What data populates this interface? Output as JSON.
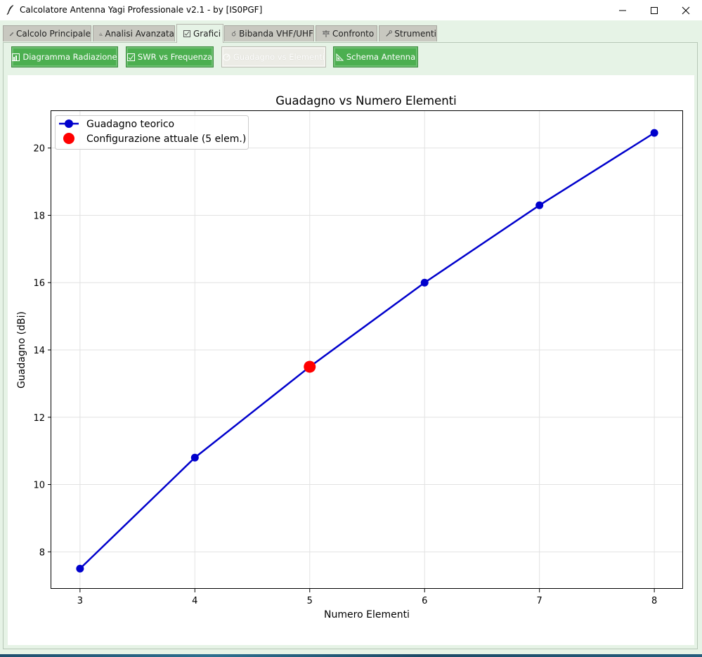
{
  "window": {
    "title": "Calcolatore Antenna Yagi Professionale v2.1 - by [IS0PGF]",
    "icon": "feather-icon",
    "controls": [
      "minimize-icon",
      "maximize-icon",
      "close-icon"
    ]
  },
  "tabs": [
    {
      "label": "Calcolo Principale",
      "icon": "pencil-icon",
      "active": false
    },
    {
      "label": "Analisi Avanzata",
      "icon": "chart-icon",
      "active": false
    },
    {
      "label": "Grafici",
      "icon": "checkbox-icon",
      "active": true
    },
    {
      "label": "Bibanda VHF/UHF",
      "icon": "satellite-icon",
      "active": false
    },
    {
      "label": "Confronto",
      "icon": "scales-icon",
      "active": false
    },
    {
      "label": "Strumenti",
      "icon": "tool-icon",
      "active": false
    }
  ],
  "chart_buttons": [
    {
      "label": "Diagramma Radiazione",
      "icon": "bar-chart-icon",
      "enabled": true
    },
    {
      "label": "SWR vs Frequenza",
      "icon": "checkbox-icon",
      "enabled": true
    },
    {
      "label": "Guadagno vs Elementi",
      "icon": "gauge-icon",
      "enabled": false
    },
    {
      "label": "Schema Antenna",
      "icon": "ruler-triangle-icon",
      "enabled": true
    }
  ],
  "chart_data": {
    "type": "line",
    "title": "Guadagno vs Numero Elementi",
    "xlabel": "Numero Elementi",
    "ylabel": "Guadagno (dBi)",
    "x": [
      3,
      4,
      5,
      6,
      7,
      8
    ],
    "series": [
      {
        "name": "Guadagno teorico",
        "values": [
          7.5,
          10.8,
          13.5,
          16.0,
          18.3,
          20.45
        ],
        "color": "#0000cc"
      }
    ],
    "highlight": {
      "name": "Configurazione attuale (5 elem.)",
      "x": 5,
      "y": 13.5,
      "color": "#ff0000"
    },
    "xlim": [
      2.75,
      8.25
    ],
    "ylim": [
      6.9,
      21.1
    ],
    "xticks": [
      3,
      4,
      5,
      6,
      7,
      8
    ],
    "yticks": [
      8,
      10,
      12,
      14,
      16,
      18,
      20
    ],
    "grid": true,
    "legend": "top-left"
  }
}
